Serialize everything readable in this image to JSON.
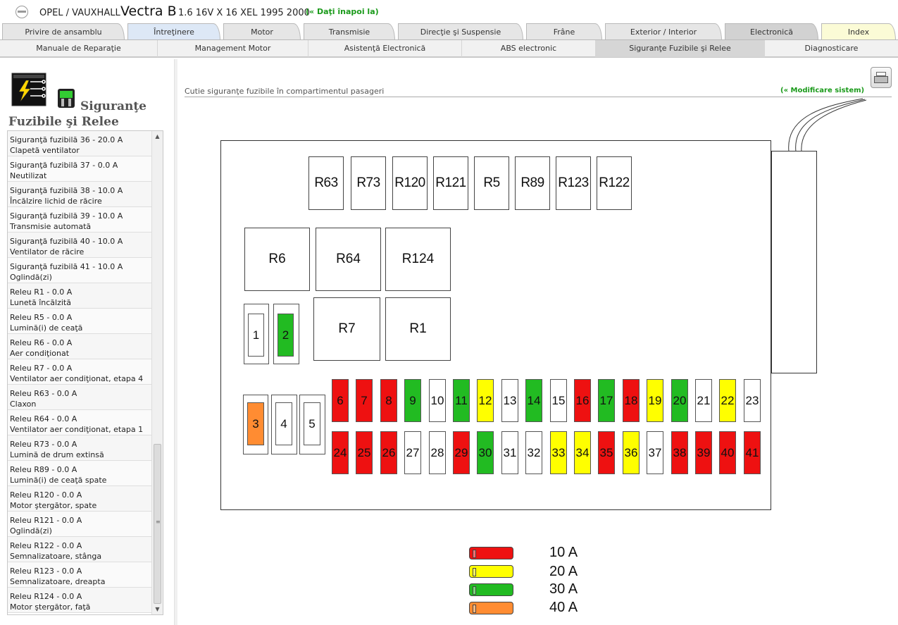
{
  "header": {
    "make": "OPEL / VAUXHALL",
    "model": "Vectra B",
    "engine": "1.6 16V X 16 XEL 1995 2000",
    "back_link": "(« Daţi înapoi la)"
  },
  "tabs_main": [
    {
      "label": "Privire de ansamblu"
    },
    {
      "label": "Întreţinere"
    },
    {
      "label": "Motor"
    },
    {
      "label": "Transmisie"
    },
    {
      "label": "Direcţie şi Suspensie"
    },
    {
      "label": "Frâne"
    },
    {
      "label": "Exterior / Interior"
    },
    {
      "label": "Electronică"
    },
    {
      "label": "Index"
    }
  ],
  "tabs_sub": [
    {
      "label": "Manuale de Reparaţie"
    },
    {
      "label": "Management Motor"
    },
    {
      "label": "Asistenţă Electronică"
    },
    {
      "label": "ABS electronic"
    },
    {
      "label": "Siguranţe Fuzibile şi Relee"
    },
    {
      "label": "Diagnosticare"
    }
  ],
  "sidebar": {
    "title_line1": "Siguranţe",
    "title_line2": "Fuzibile şi Relee",
    "items": [
      {
        "line1": "Siguranţă fuzibilă 36 - 20.0 A",
        "line2": "Clapetă ventilator"
      },
      {
        "line1": "Siguranţă fuzibilă 37 - 0.0 A",
        "line2": "Neutilizat"
      },
      {
        "line1": "Siguranţă fuzibilă 38 - 10.0 A",
        "line2": "Încălzire lichid de răcire"
      },
      {
        "line1": "Siguranţă fuzibilă 39 - 10.0 A",
        "line2": "Transmisie automată"
      },
      {
        "line1": "Siguranţă fuzibilă 40 - 10.0 A",
        "line2": "Ventilator de răcire"
      },
      {
        "line1": "Siguranţă fuzibilă 41 - 10.0 A",
        "line2": "Oglindă(zi)"
      },
      {
        "line1": "Releu R1 - 0.0 A",
        "line2": "Lunetă încălzită"
      },
      {
        "line1": "Releu R5 - 0.0 A",
        "line2": "Lumină(i) de ceaţă"
      },
      {
        "line1": "Releu R6 - 0.0 A",
        "line2": "Aer condiţionat"
      },
      {
        "line1": "Releu R7 - 0.0 A",
        "line2": "Ventilator aer condiţionat, etapa 4"
      },
      {
        "line1": "Releu R63 - 0.0 A",
        "line2": "Claxon"
      },
      {
        "line1": "Releu R64 - 0.0 A",
        "line2": "Ventilator aer condiţionat, etapa 1"
      },
      {
        "line1": "Releu R73 - 0.0 A",
        "line2": "Lumină de drum extinsă"
      },
      {
        "line1": "Releu R89 - 0.0 A",
        "line2": "Lumină(i) de ceaţă spate"
      },
      {
        "line1": "Releu R120 - 0.0 A",
        "line2": "Motor ştergător, spate"
      },
      {
        "line1": "Releu R121 - 0.0 A",
        "line2": "Oglindă(zi)"
      },
      {
        "line1": "Releu R122 - 0.0 A",
        "line2": "Semnalizatoare, stânga"
      },
      {
        "line1": "Releu R123 - 0.0 A",
        "line2": "Semnalizatoare, dreapta"
      },
      {
        "line1": "Releu R124 - 0.0 A",
        "line2": "Motor ştergător, faţă"
      }
    ]
  },
  "diagram": {
    "title": "Cutie siguranţe fuzibile în compartimentul pasageri",
    "modify_link": "(« Modificare sistem)",
    "relays": [
      {
        "label": "R63"
      },
      {
        "label": "R73"
      },
      {
        "label": "R120"
      },
      {
        "label": "R121"
      },
      {
        "label": "R5"
      },
      {
        "label": "R89"
      },
      {
        "label": "R123"
      },
      {
        "label": "R122"
      },
      {
        "label": "R6"
      },
      {
        "label": "R64"
      },
      {
        "label": "R124"
      },
      {
        "label": "R7"
      },
      {
        "label": "R1"
      }
    ],
    "fuses": [
      {
        "label": "1",
        "color": "white"
      },
      {
        "label": "2",
        "color": "green"
      },
      {
        "label": "3",
        "color": "orange"
      },
      {
        "label": "4",
        "color": "white"
      },
      {
        "label": "5",
        "color": "white"
      },
      {
        "label": "6",
        "color": "red"
      },
      {
        "label": "7",
        "color": "red"
      },
      {
        "label": "8",
        "color": "red"
      },
      {
        "label": "9",
        "color": "green"
      },
      {
        "label": "10",
        "color": "white"
      },
      {
        "label": "11",
        "color": "green"
      },
      {
        "label": "12",
        "color": "yellow"
      },
      {
        "label": "13",
        "color": "white"
      },
      {
        "label": "14",
        "color": "green"
      },
      {
        "label": "15",
        "color": "white"
      },
      {
        "label": "16",
        "color": "red"
      },
      {
        "label": "17",
        "color": "green"
      },
      {
        "label": "18",
        "color": "red"
      },
      {
        "label": "19",
        "color": "yellow"
      },
      {
        "label": "20",
        "color": "green"
      },
      {
        "label": "21",
        "color": "white"
      },
      {
        "label": "22",
        "color": "yellow"
      },
      {
        "label": "23",
        "color": "white"
      },
      {
        "label": "24",
        "color": "red"
      },
      {
        "label": "25",
        "color": "red"
      },
      {
        "label": "26",
        "color": "red"
      },
      {
        "label": "27",
        "color": "white"
      },
      {
        "label": "28",
        "color": "white"
      },
      {
        "label": "29",
        "color": "red"
      },
      {
        "label": "30",
        "color": "green"
      },
      {
        "label": "31",
        "color": "white"
      },
      {
        "label": "32",
        "color": "white"
      },
      {
        "label": "33",
        "color": "yellow"
      },
      {
        "label": "34",
        "color": "yellow"
      },
      {
        "label": "35",
        "color": "red"
      },
      {
        "label": "36",
        "color": "yellow"
      },
      {
        "label": "37",
        "color": "white"
      },
      {
        "label": "38",
        "color": "red"
      },
      {
        "label": "39",
        "color": "red"
      },
      {
        "label": "40",
        "color": "red"
      },
      {
        "label": "41",
        "color": "red"
      }
    ],
    "legend": [
      {
        "label": "10 A",
        "color": "#ee1111"
      },
      {
        "label": "20 A",
        "color": "#ffff00"
      },
      {
        "label": "30 A",
        "color": "#22bb22"
      },
      {
        "label": "40 A",
        "color": "#ff8c32"
      }
    ]
  }
}
